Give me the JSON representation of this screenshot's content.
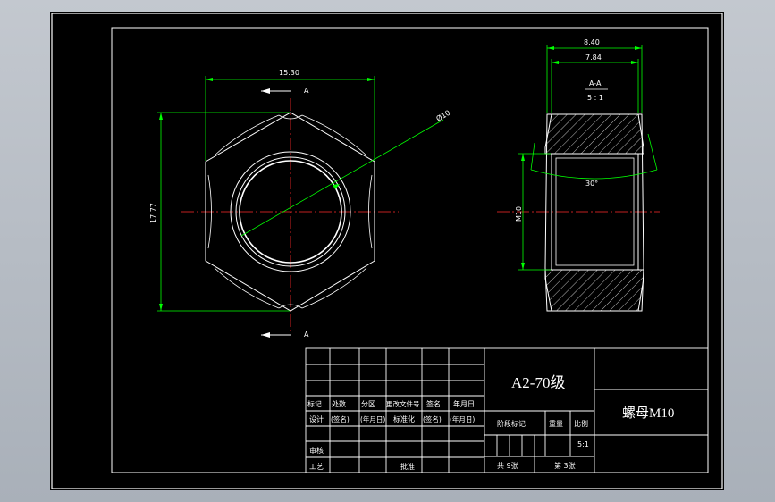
{
  "drawing": {
    "top_view": {
      "dim_width": "15.30",
      "dim_height": "17.77",
      "dim_diameter": "Ø10",
      "section_mark": "A"
    },
    "side_view": {
      "dim_overall": "8.40",
      "dim_inner": "7.84",
      "section_label": "A-A",
      "scale_label": "5 : 1",
      "angle_label": "30°",
      "thread_label": "M10"
    }
  },
  "title_block": {
    "material": "A2-70级",
    "part_name": "螺母M10",
    "scale_value": "5:1",
    "headers": {
      "mark": "标记",
      "count": "处数",
      "zone": "分区",
      "change_doc": "更改文件号",
      "sign": "签名",
      "date": "年月日"
    },
    "rows": {
      "design": "设计",
      "sign_hint": "(签名)",
      "date_hint": "(年月日)",
      "standardize": "标准化",
      "review": "审核",
      "process": "工艺",
      "approve": "批准"
    },
    "right": {
      "stage_mark": "阶段标记",
      "weight": "重量",
      "scale": "比例",
      "total_sheets": "共  9张",
      "sheet_no": "第  3张"
    }
  }
}
